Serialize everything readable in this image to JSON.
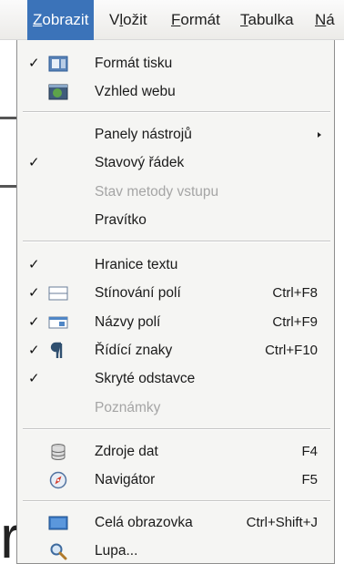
{
  "menubar": {
    "items": [
      {
        "label": "Zobrazit",
        "u": "Z",
        "rest": "obrazit",
        "active": true
      },
      {
        "label": "Vložit",
        "u": "l",
        "pre": "V",
        "rest": "ožit"
      },
      {
        "label": "Formát",
        "u": "F",
        "rest": "ormát"
      },
      {
        "label": "Tabulka",
        "u": "T",
        "rest": "abulka"
      },
      {
        "label": "Ná",
        "u": "N",
        "rest": "á"
      }
    ]
  },
  "menu": {
    "items": [
      {
        "label": "Formát tisku",
        "checked": true,
        "icon": "print-layout-icon"
      },
      {
        "label": "Vzhled webu",
        "icon": "web-layout-icon"
      },
      {
        "label": "Panely nástrojů",
        "submenu": true
      },
      {
        "label": "Stavový řádek",
        "checked": true
      },
      {
        "label": "Stav metody vstupu",
        "disabled": true
      },
      {
        "label": "Pravítko"
      },
      {
        "label": "Hranice textu",
        "checked": true
      },
      {
        "label": "Stínování polí",
        "checked": true,
        "icon": "field-shading-icon",
        "shortcut": "Ctrl+F8"
      },
      {
        "label": "Názvy polí",
        "checked": true,
        "icon": "field-names-icon",
        "shortcut": "Ctrl+F9"
      },
      {
        "label": "Řídící znaky",
        "checked": true,
        "icon": "pilcrow-icon",
        "shortcut": "Ctrl+F10"
      },
      {
        "label": "Skryté odstavce",
        "checked": true
      },
      {
        "label": "Poznámky",
        "disabled": true
      },
      {
        "label": "Zdroje dat",
        "icon": "database-icon",
        "shortcut": "F4"
      },
      {
        "label": "Navigátor",
        "icon": "compass-icon",
        "shortcut": "F5"
      },
      {
        "label": "Celá obrazovka",
        "icon": "full-screen-icon",
        "shortcut": "Ctrl+Shift+J"
      },
      {
        "label": "Lupa...",
        "icon": "magnifier-icon"
      }
    ]
  },
  "checkmark": "✓",
  "background_letter": "r"
}
